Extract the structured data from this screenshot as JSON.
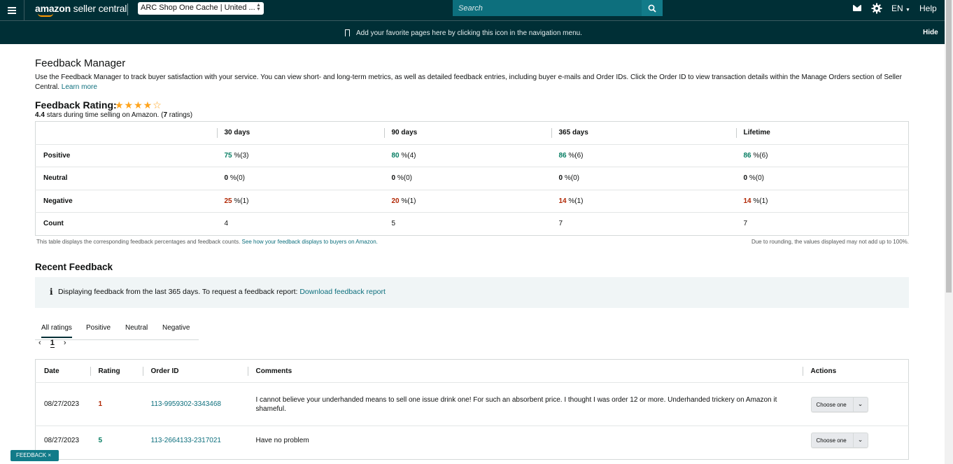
{
  "topbar": {
    "logo_text": "amazon",
    "logo_suffix": "seller central",
    "account": "ARC Shop One Cache | United ...",
    "search_placeholder": "Search",
    "language": "EN",
    "help": "Help"
  },
  "navbar": {
    "message": "Add your favorite pages here by clicking this icon in the navigation menu.",
    "hide": "Hide"
  },
  "feedback_manager": {
    "title": "Feedback Manager",
    "description": "Use the Feedback Manager to track buyer satisfaction with your service. You can view short- and long-term metrics, as well as detailed feedback entries, including buyer e-mails and Order IDs. Click the Order ID to view transaction details within the Manage Orders section of Seller Central.",
    "learn_more": "Learn more",
    "rating_title": "Feedback Rating:",
    "stars_value": 4.4,
    "stars_display": "★★★★☆",
    "rating_value": "4.4",
    "rating_text": "stars during time selling on Amazon.",
    "rating_count_prefix": "(",
    "rating_count": "7",
    "rating_count_suffix": "ratings)"
  },
  "metrics": {
    "columns": [
      "30 days",
      "90 days",
      "365 days",
      "Lifetime"
    ],
    "rows": [
      {
        "label": "Positive",
        "cells": [
          {
            "v": "75",
            "r": " %(3)"
          },
          {
            "v": "80",
            "r": " %(4)"
          },
          {
            "v": "86",
            "r": " %(6)"
          },
          {
            "v": "86",
            "r": " %(6)"
          }
        ]
      },
      {
        "label": "Neutral",
        "cells": [
          {
            "v": "0",
            "r": " %(0)"
          },
          {
            "v": "0",
            "r": " %(0)"
          },
          {
            "v": "0",
            "r": " %(0)"
          },
          {
            "v": "0",
            "r": " %(0)"
          }
        ]
      },
      {
        "label": "Negative",
        "cells": [
          {
            "v": "25",
            "r": " %(1)"
          },
          {
            "v": "20",
            "r": " %(1)"
          },
          {
            "v": "14",
            "r": " %(1)"
          },
          {
            "v": "14",
            "r": " %(1)"
          }
        ]
      },
      {
        "label": "Count",
        "cells": [
          {
            "v": "4"
          },
          {
            "v": "5"
          },
          {
            "v": "7"
          },
          {
            "v": "7"
          }
        ]
      }
    ],
    "note": "This table displays the corresponding feedback percentages and feedback counts.",
    "note_link": "See how your feedback displays to buyers on Amazon.",
    "rounding_note": "Due to rounding, the values displayed may not add up to 100%."
  },
  "recent": {
    "title": "Recent Feedback",
    "info_text": "Displaying feedback from the last 365 days. To request a feedback report:",
    "info_link": "Download feedback report",
    "tabs": [
      "All ratings",
      "Positive",
      "Neutral",
      "Negative"
    ],
    "page": "1",
    "headers": [
      "Date",
      "Rating",
      "Order ID",
      "Comments",
      "Actions"
    ],
    "rows": [
      {
        "date": "08/27/2023",
        "rating": "1",
        "order_id": "113-9959302-3343468",
        "comment": "I cannot believe your underhanded means to sell one issue drink one! For such an absorbent price. I thought I was order 12 or more. Underhanded trickery on Amazon it shameful.",
        "action": "Choose one"
      },
      {
        "date": "08/27/2023",
        "rating": "5",
        "order_id": "113-2664133-2317021",
        "comment": "Have no problem",
        "action": "Choose one"
      }
    ]
  },
  "feedback_tag": "FEEDBACK ×",
  "colors": {
    "header_bg": "#002f36",
    "positive": "#067d62",
    "negative": "#b12704",
    "link": "#0d6f7d",
    "stars": "#ffa41c"
  }
}
